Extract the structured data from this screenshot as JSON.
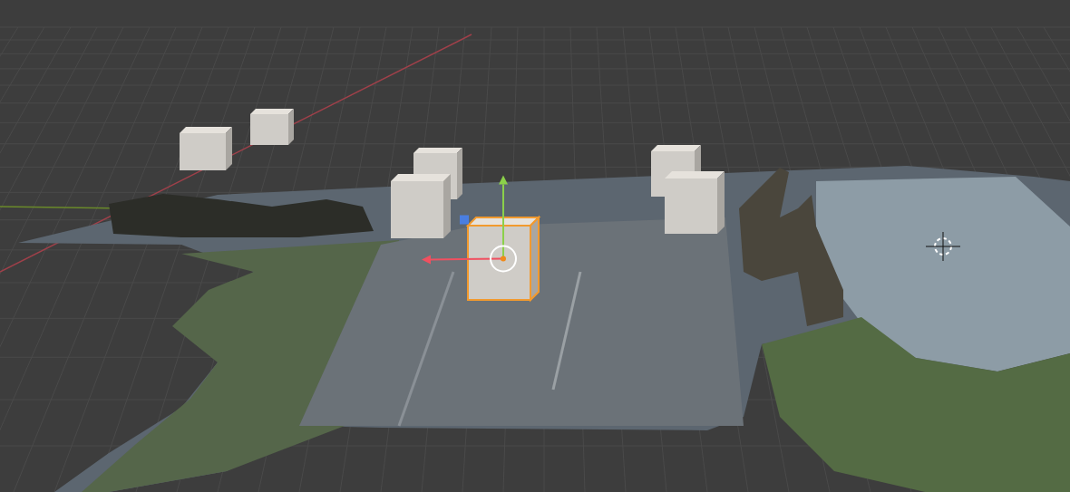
{
  "viewport": {
    "cubes": [
      {
        "selected": false
      },
      {
        "selected": false
      },
      {
        "selected": false
      },
      {
        "selected": false
      },
      {
        "selected": true
      },
      {
        "selected": false
      },
      {
        "selected": false
      }
    ]
  }
}
